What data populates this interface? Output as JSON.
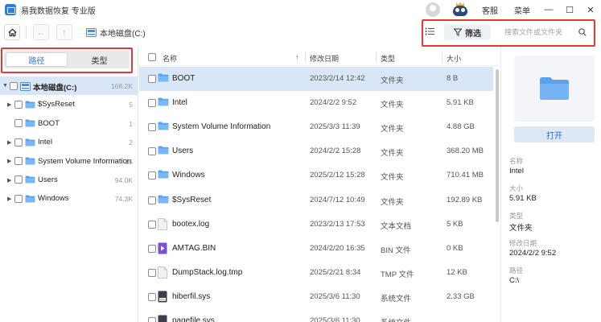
{
  "app": {
    "title": "易我数据恢复 专业版"
  },
  "titlebar": {
    "service": "客服",
    "menu": "菜单",
    "minimize": "—",
    "maximize": "☐",
    "close": "✕"
  },
  "toolbar": {
    "breadcrumb": "本地磁盘(C:)",
    "filter_label": "筛选",
    "search_placeholder": "搜索文件或文件夹"
  },
  "left": {
    "tabs": [
      {
        "label": "路径",
        "active": true
      },
      {
        "label": "类型",
        "active": false
      }
    ],
    "tree": [
      {
        "label": "本地磁盘(C:)",
        "count": "168.2K",
        "level": 0,
        "expandable": true,
        "expanded": true,
        "selected": true,
        "bold": true
      },
      {
        "label": "$SysReset",
        "count": "5",
        "level": 1,
        "expandable": true
      },
      {
        "label": "BOOT",
        "count": "1",
        "level": 1,
        "expandable": false
      },
      {
        "label": "Intel",
        "count": "2",
        "level": 1,
        "expandable": true
      },
      {
        "label": "System Volume Information",
        "count": "15",
        "level": 1,
        "expandable": true
      },
      {
        "label": "Users",
        "count": "94.0K",
        "level": 1,
        "expandable": true
      },
      {
        "label": "Windows",
        "count": "74.3K",
        "level": 1,
        "expandable": true
      }
    ]
  },
  "list": {
    "columns": {
      "name": "名称",
      "date": "修改日期",
      "type": "类型",
      "size": "大小"
    },
    "rows": [
      {
        "name": "BOOT",
        "date": "2023/2/14 12:42",
        "type": "文件夹",
        "size": "8 B",
        "icon": "folder-icon",
        "selected": true
      },
      {
        "name": "Intel",
        "date": "2024/2/2 9:52",
        "type": "文件夹",
        "size": "5.91 KB",
        "icon": "folder-icon"
      },
      {
        "name": "System Volume Information",
        "date": "2025/3/3 11:39",
        "type": "文件夹",
        "size": "4.88 GB",
        "icon": "folder-icon"
      },
      {
        "name": "Users",
        "date": "2024/2/2 15:28",
        "type": "文件夹",
        "size": "368.20 MB",
        "icon": "folder-icon"
      },
      {
        "name": "Windows",
        "date": "2025/2/12 15:28",
        "type": "文件夹",
        "size": "710.41 MB",
        "icon": "folder-icon"
      },
      {
        "name": "$SysReset",
        "date": "2024/7/12 10:49",
        "type": "文件夹",
        "size": "192.89 KB",
        "icon": "folder-icon"
      },
      {
        "name": "bootex.log",
        "date": "2023/2/13 17:53",
        "type": "文本文档",
        "size": "5 KB",
        "icon": "document-icon"
      },
      {
        "name": "AMTAG.BIN",
        "date": "2024/2/20 16:35",
        "type": "BIN 文件",
        "size": "0 KB",
        "icon": "media-icon"
      },
      {
        "name": "DumpStack.log.tmp",
        "date": "2025/2/21 8:34",
        "type": "TMP 文件",
        "size": "12 KB",
        "icon": "document-icon"
      },
      {
        "name": "hiberfil.sys",
        "date": "2025/3/6 11:30",
        "type": "系统文件",
        "size": "2.33 GB",
        "icon": "sys-file-icon"
      },
      {
        "name": "pagefile.sys",
        "date": "2025/3/6 11:30",
        "type": "系统文件",
        "size": "",
        "icon": "sys-file-icon"
      }
    ]
  },
  "details": {
    "open_label": "打开",
    "props": [
      {
        "key": "名称",
        "value": "Intel"
      },
      {
        "key": "大小",
        "value": "5.91 KB"
      },
      {
        "key": "类型",
        "value": "文件夹"
      },
      {
        "key": "修改日期",
        "value": "2024/2/2 9:52"
      },
      {
        "key": "路径",
        "value": "C:\\"
      }
    ]
  },
  "colors": {
    "accent": "#2a6fd6",
    "selection": "#d9e6f8",
    "highlight_border": "#e03a3a",
    "folder": "#5aa1ee"
  }
}
